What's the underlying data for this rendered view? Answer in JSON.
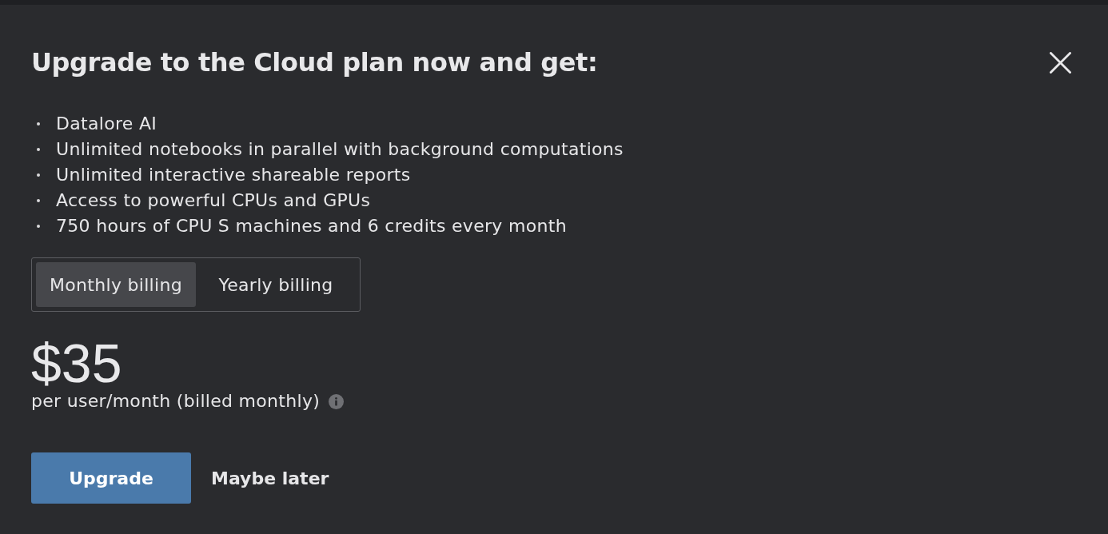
{
  "dialog": {
    "title": "Upgrade to the Cloud plan now and get:",
    "features": [
      "Datalore AI",
      "Unlimited notebooks in parallel with background computations",
      "Unlimited interactive shareable reports",
      "Access to powerful CPUs and GPUs",
      "750 hours of CPU S machines and 6 credits every month"
    ],
    "billing_tabs": [
      {
        "label": "Monthly billing",
        "selected": true
      },
      {
        "label": "Yearly billing",
        "selected": false
      }
    ],
    "price": "$35",
    "price_note": "per user/month (billed monthly)",
    "buttons": [
      {
        "label": "Upgrade",
        "kind": "primary"
      },
      {
        "label": "Maybe later",
        "kind": "text"
      }
    ]
  }
}
